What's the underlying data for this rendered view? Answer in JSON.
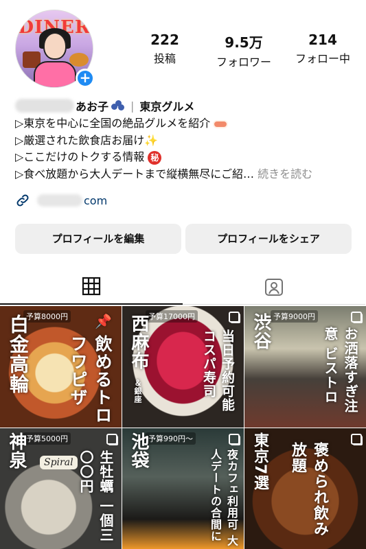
{
  "profile": {
    "stats": [
      {
        "value": "222",
        "label": "投稿"
      },
      {
        "value": "9.5万",
        "label": "フォロワー"
      },
      {
        "value": "214",
        "label": "フォロー中"
      }
    ],
    "name": "あお子",
    "category": "東京グルメ",
    "avatar_sign": "DINER",
    "add_icon": "+"
  },
  "bio": {
    "line1": "▷東京を中心に全国の絶品グルメを紹介",
    "line2": "▷厳選された飲食店お届け",
    "line3": "▷ここだけのトクする情報",
    "line4": "▷食べ放題から大人デートまで縦横無尽にご紹…",
    "more": "続きを読む",
    "secret_badge": "秘"
  },
  "link": {
    "suffix": "com",
    "icon": "link-icon"
  },
  "buttons": {
    "edit": "プロフィールを編集",
    "share": "プロフィールをシェア"
  },
  "tabs": [
    {
      "icon": "grid-icon"
    },
    {
      "icon": "tagged-person-icon"
    }
  ],
  "posts": [
    {
      "budget": "予算8000円",
      "title": "白金高輪",
      "subtitle": "飲めるトロフワピザ"
    },
    {
      "budget": "予算17000円",
      "title": "西麻布",
      "note": "＆銀座",
      "subtitle": "当日予約可能 コスパ寿司"
    },
    {
      "budget": "予算9000円",
      "title": "渋谷",
      "subtitle": "お洒落すぎ注意 ビストロ"
    },
    {
      "budget": "予算5000円",
      "title": "神泉",
      "subtitle": "生牡蠣 一個三〇〇円",
      "sign": "Spiral"
    },
    {
      "budget": "予算990円〜",
      "title": "池袋",
      "subtitle": "夜カフェ利用可 大人デートの合間に"
    },
    {
      "title": "東京7選",
      "subtitle": "褒められ飲み放題"
    }
  ],
  "colors": {
    "accent": "#1f8bf3",
    "button_bg": "#efefef",
    "link": "#00376b",
    "muted": "#8e8e8e"
  }
}
